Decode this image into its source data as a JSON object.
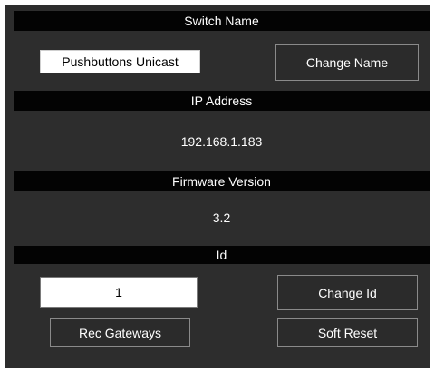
{
  "switch_name": {
    "header": "Switch Name",
    "name_value": "Pushbuttons Unicast",
    "change_name_label": "Change Name"
  },
  "ip_address": {
    "header": "IP Address",
    "value": "192.168.1.183"
  },
  "firmware": {
    "header": "Firmware Version",
    "value": "3.2"
  },
  "id_section": {
    "header": "Id",
    "id_value": "1",
    "change_id_label": "Change Id"
  },
  "actions": {
    "rec_gateways_label": "Rec Gateways",
    "soft_reset_label": "Soft Reset"
  }
}
